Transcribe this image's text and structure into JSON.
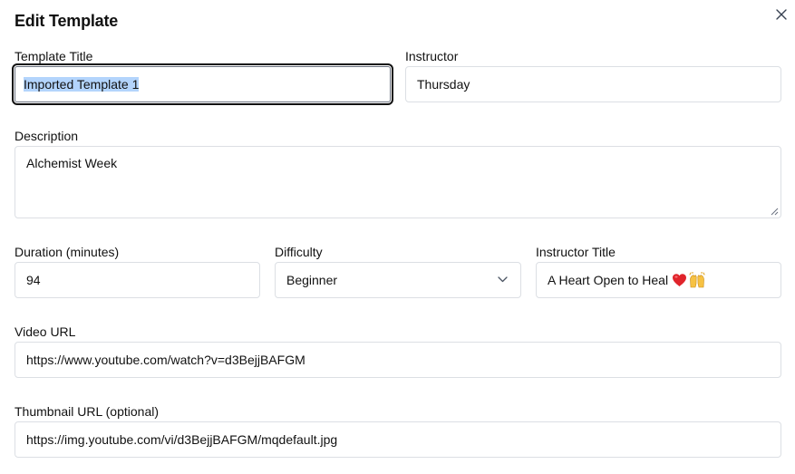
{
  "dialog": {
    "title": "Edit Template",
    "close_icon": "close-icon"
  },
  "fields": {
    "template_title": {
      "label": "Template Title",
      "value": "Imported Template 1"
    },
    "instructor": {
      "label": "Instructor",
      "value": "Thursday"
    },
    "description": {
      "label": "Description",
      "value": "Alchemist Week"
    },
    "duration": {
      "label": "Duration (minutes)",
      "value": "94"
    },
    "difficulty": {
      "label": "Difficulty",
      "value": "Beginner"
    },
    "instructor_title": {
      "label": "Instructor Title",
      "value": "A Heart Open to Heal",
      "emojis": [
        "heart-emoji",
        "raised-hands-emoji"
      ]
    },
    "video_url": {
      "label": "Video URL",
      "value": "https://www.youtube.com/watch?v=d3BejjBAFGM"
    },
    "thumbnail_url": {
      "label": "Thumbnail URL (optional)",
      "value": "https://img.youtube.com/vi/d3BejjBAFGM/mqdefault.jpg"
    }
  },
  "colors": {
    "border": "#dcdfe4",
    "focus_border": "#111111",
    "selection": "#b3d4fc"
  }
}
